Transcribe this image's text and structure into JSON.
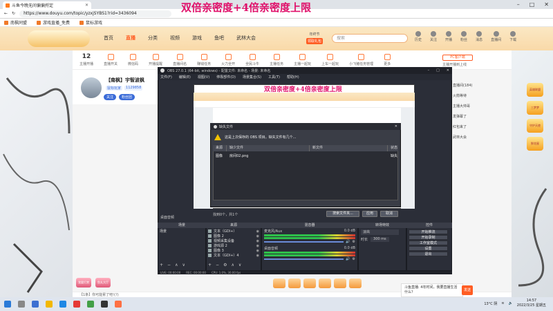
{
  "overlay_title": "双倍亲密度+4倍亲密度上限",
  "browser": {
    "tab_title": "斗鱼今晚无间偏偏捋定",
    "url": "https://www.douyu.com/topic/yzxjSYBS1?rid=3436094",
    "bookmarks": [
      "南枫同盟",
      "游戏直播_免费",
      "鼠标游戏"
    ],
    "window_controls": [
      "–",
      "□",
      "✕"
    ]
  },
  "douyu_nav": {
    "links": [
      "首页",
      "直播",
      "分类",
      "视频",
      "游戏",
      "鱼吧",
      "武林大会"
    ],
    "active": "直播",
    "ticker_label": "年终节",
    "ticker_button": "领取礼包",
    "search_placeholder": "搜索",
    "right_icons": [
      "历史",
      "关注",
      "开播",
      "粉丝",
      "消息",
      "直播间",
      "下载"
    ]
  },
  "icon_row": {
    "count": "12",
    "count_label": "主播开播",
    "items": [
      "直播开关",
      "微信码",
      "开播提醒",
      "直播间名",
      "赚钱任务",
      "火力全开",
      "全民斗牛",
      "主播任务",
      "主播一起玩",
      "上车一起玩",
      "小飞猪任务管理",
      "更多"
    ],
    "pc_button": "PC客户端",
    "phone_link": "主播开播到上线"
  },
  "streamer": {
    "name": "【南枫】宇智波枫",
    "tag1": "鼠标玩家",
    "fans": "1129858",
    "btn1": "关注",
    "btn2": "粉丝团"
  },
  "obs": {
    "title": "OBS 27.0.1 (64-bit, windows) - 配置文件: 未命名 - 场景: 未命名",
    "menu": [
      "文件(F)",
      "编辑(E)",
      "视图(V)",
      "停靠部件(D)",
      "场景集合(S)",
      "工具(T)",
      "帮助(H)"
    ],
    "preview_title": "双倍亲密度+4倍亲密度上限",
    "dialog": {
      "title": "缺失文件",
      "warning": "这是上次保存的 OBS 项目。缺失文件有几个...",
      "headers": [
        "来源",
        "缺少文件",
        "新文件",
        "状态"
      ],
      "rows": [
        {
          "source": "图像",
          "file": "房间02.png",
          "state": "缺失"
        }
      ],
      "count_text": "找到0个，共1个",
      "btn_search": "搜索文件夹...",
      "btn_apply": "应用",
      "btn_cancel": "取消"
    },
    "desktop_label": "桌面音频",
    "docks": {
      "scenes": "场景",
      "sources": "来源",
      "mixer": "混音器",
      "transitions": "转场特效",
      "controls": "控件"
    },
    "scene_items": [
      "场景"
    ],
    "source_items": [
      "文本（GDI+）",
      "图像 2",
      "视频采集设备",
      "游戏源 2",
      "图像 3",
      "文本（GDI+）4"
    ],
    "mixer_items": [
      {
        "name": "麦克风/Aux",
        "db": "0.0 dB"
      },
      {
        "name": "桌面音频",
        "db": "0.0 dB"
      }
    ],
    "transition": {
      "type": "淡出",
      "duration_label": "时长",
      "duration": "300 ms"
    },
    "control_buttons": [
      "开始推流",
      "开始录制",
      "工作室模式",
      "设置",
      "退出"
    ],
    "status": [
      "LIVE: 00:00:00",
      "REC: 00:00:00",
      "CPU: 1.0%, 30.00 fps"
    ]
  },
  "bottom_badges": [
    "我要打赏",
    "鱼丸大厅"
  ],
  "chat": {
    "placeholder": "【1条】你可能累了吧!(?)",
    "right_messages": [
      "直播间(184)",
      "火箭等待",
      "主播大帅哥",
      "发弹幕了",
      "红包来了",
      "武林大会"
    ],
    "send": "发送",
    "notif_line1": "斗鱼直播: 4年时间，我要直播生活什么？",
    "notif_line2": "..."
  },
  "right_badges": [
    "英雄联盟",
    "三梦梦",
    "守护天使",
    "鲜花屋"
  ],
  "taskbar": {
    "weather": "13°C 阴",
    "time": "14:57",
    "date": "2022/3/25 星期五"
  }
}
